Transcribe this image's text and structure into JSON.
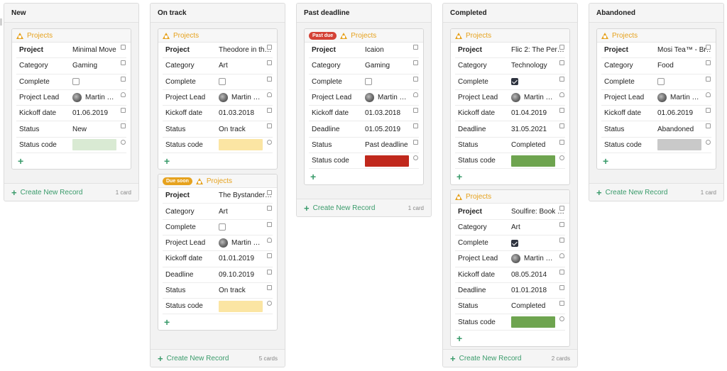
{
  "table_label": "Projects",
  "create_label": "Create New Record",
  "colors": {
    "accent": "#3a9b6b",
    "table_icon": "#e6a21e",
    "badge_past_due": "#d44236",
    "badge_due_soon": "#e6a21e"
  },
  "columns": [
    {
      "title": "New",
      "count": "1 card",
      "cards": [
        {
          "badge": null,
          "fields": [
            {
              "label": "Project",
              "value": "Minimal Move",
              "type": "text",
              "icon": "text-icon"
            },
            {
              "label": "Category",
              "value": "Gaming",
              "type": "text",
              "icon": "select-icon"
            },
            {
              "label": "Complete",
              "value": "",
              "type": "checkbox",
              "checked": false,
              "icon": "checkbox-icon"
            },
            {
              "label": "Project Lead",
              "value": "Martin …",
              "type": "user",
              "icon": "user-icon"
            },
            {
              "label": "Kickoff date",
              "value": "01.06.2019",
              "type": "text",
              "icon": "calendar-icon"
            },
            {
              "label": "Status",
              "value": "New",
              "type": "text",
              "icon": "select-icon"
            },
            {
              "label": "Status code",
              "value": "",
              "type": "color",
              "color": "#d9ead3",
              "icon": "palette-icon"
            }
          ]
        }
      ]
    },
    {
      "title": "On track",
      "count": "5 cards",
      "cards": [
        {
          "badge": null,
          "fields": [
            {
              "label": "Project",
              "value": "Theodore in th…",
              "type": "text",
              "icon": "text-icon"
            },
            {
              "label": "Category",
              "value": "Art",
              "type": "text",
              "icon": "select-icon"
            },
            {
              "label": "Complete",
              "value": "",
              "type": "checkbox",
              "checked": false,
              "icon": "checkbox-icon"
            },
            {
              "label": "Project Lead",
              "value": "Martin …",
              "type": "user",
              "icon": "user-icon"
            },
            {
              "label": "Kickoff date",
              "value": "01.03.2018",
              "type": "text",
              "icon": "calendar-icon"
            },
            {
              "label": "Status",
              "value": "On track",
              "type": "text",
              "icon": "select-icon"
            },
            {
              "label": "Status code",
              "value": "",
              "type": "color",
              "color": "#fbe5a3",
              "icon": "palette-icon"
            }
          ]
        },
        {
          "badge": {
            "text": "Due soon",
            "color": "#e6a21e"
          },
          "fields": [
            {
              "label": "Project",
              "value": "The Bystander…",
              "type": "text",
              "icon": "text-icon"
            },
            {
              "label": "Category",
              "value": "Art",
              "type": "text",
              "icon": "select-icon"
            },
            {
              "label": "Complete",
              "value": "",
              "type": "checkbox",
              "checked": false,
              "icon": "checkbox-icon"
            },
            {
              "label": "Project Lead",
              "value": "Martin …",
              "type": "user",
              "icon": "user-icon"
            },
            {
              "label": "Kickoff date",
              "value": "01.01.2019",
              "type": "text",
              "icon": "calendar-icon"
            },
            {
              "label": "Deadline",
              "value": "09.10.2019",
              "type": "text",
              "icon": "calendar-icon"
            },
            {
              "label": "Status",
              "value": "On track",
              "type": "text",
              "icon": "select-icon"
            },
            {
              "label": "Status code",
              "value": "",
              "type": "color",
              "color": "#fbe5a3",
              "icon": "palette-icon"
            }
          ]
        }
      ]
    },
    {
      "title": "Past deadline",
      "count": "1 card",
      "cards": [
        {
          "badge": {
            "text": "Past due",
            "color": "#d44236"
          },
          "fields": [
            {
              "label": "Project",
              "value": "Icaion",
              "type": "text",
              "icon": "text-icon"
            },
            {
              "label": "Category",
              "value": "Gaming",
              "type": "text",
              "icon": "select-icon"
            },
            {
              "label": "Complete",
              "value": "",
              "type": "checkbox",
              "checked": false,
              "icon": "checkbox-icon"
            },
            {
              "label": "Project Lead",
              "value": "Martin …",
              "type": "user",
              "icon": "user-icon"
            },
            {
              "label": "Kickoff date",
              "value": "01.03.2018",
              "type": "text",
              "icon": "calendar-icon"
            },
            {
              "label": "Deadline",
              "value": "01.05.2019",
              "type": "text",
              "icon": "calendar-icon"
            },
            {
              "label": "Status",
              "value": "Past deadline",
              "type": "text",
              "icon": "select-icon"
            },
            {
              "label": "Status code",
              "value": "",
              "type": "color",
              "color": "#c0281c",
              "icon": "palette-icon"
            }
          ]
        }
      ]
    },
    {
      "title": "Completed",
      "count": "2 cards",
      "cards": [
        {
          "badge": null,
          "fields": [
            {
              "label": "Project",
              "value": "Flic 2: The Per…",
              "type": "text",
              "icon": "text-icon"
            },
            {
              "label": "Category",
              "value": "Technology",
              "type": "text",
              "icon": "select-icon"
            },
            {
              "label": "Complete",
              "value": "",
              "type": "checkbox",
              "checked": true,
              "icon": "checkbox-icon"
            },
            {
              "label": "Project Lead",
              "value": "Martin …",
              "type": "user",
              "icon": "user-icon"
            },
            {
              "label": "Kickoff date",
              "value": "01.04.2019",
              "type": "text",
              "icon": "calendar-icon"
            },
            {
              "label": "Deadline",
              "value": "31.05.2021",
              "type": "text",
              "icon": "calendar-icon"
            },
            {
              "label": "Status",
              "value": "Completed",
              "type": "text",
              "icon": "select-icon"
            },
            {
              "label": "Status code",
              "value": "",
              "type": "color",
              "color": "#6ea44f",
              "icon": "palette-icon"
            }
          ]
        },
        {
          "badge": null,
          "fields": [
            {
              "label": "Project",
              "value": "Soulfire: Book …",
              "type": "text",
              "icon": "text-icon"
            },
            {
              "label": "Category",
              "value": "Art",
              "type": "text",
              "icon": "select-icon"
            },
            {
              "label": "Complete",
              "value": "",
              "type": "checkbox",
              "checked": true,
              "icon": "checkbox-icon"
            },
            {
              "label": "Project Lead",
              "value": "Martin …",
              "type": "user",
              "icon": "user-icon"
            },
            {
              "label": "Kickoff date",
              "value": "08.05.2014",
              "type": "text",
              "icon": "calendar-icon"
            },
            {
              "label": "Deadline",
              "value": "01.01.2018",
              "type": "text",
              "icon": "calendar-icon"
            },
            {
              "label": "Status",
              "value": "Completed",
              "type": "text",
              "icon": "select-icon"
            },
            {
              "label": "Status code",
              "value": "",
              "type": "color",
              "color": "#6ea44f",
              "icon": "palette-icon"
            }
          ]
        }
      ]
    },
    {
      "title": "Abandoned",
      "count": "1 card",
      "cards": [
        {
          "badge": null,
          "fields": [
            {
              "label": "Project",
              "value": "Mosi Tea™ - Br…",
              "type": "text",
              "icon": "text-icon"
            },
            {
              "label": "Category",
              "value": "Food",
              "type": "text",
              "icon": "select-icon"
            },
            {
              "label": "Complete",
              "value": "",
              "type": "checkbox",
              "checked": false,
              "icon": "checkbox-icon"
            },
            {
              "label": "Project Lead",
              "value": "Martin …",
              "type": "user",
              "icon": "user-icon"
            },
            {
              "label": "Kickoff date",
              "value": "01.06.2019",
              "type": "text",
              "icon": "calendar-icon"
            },
            {
              "label": "Status",
              "value": "Abandoned",
              "type": "text",
              "icon": "select-icon"
            },
            {
              "label": "Status code",
              "value": "",
              "type": "color",
              "color": "#c9c9c9",
              "icon": "palette-icon"
            }
          ]
        }
      ]
    }
  ]
}
